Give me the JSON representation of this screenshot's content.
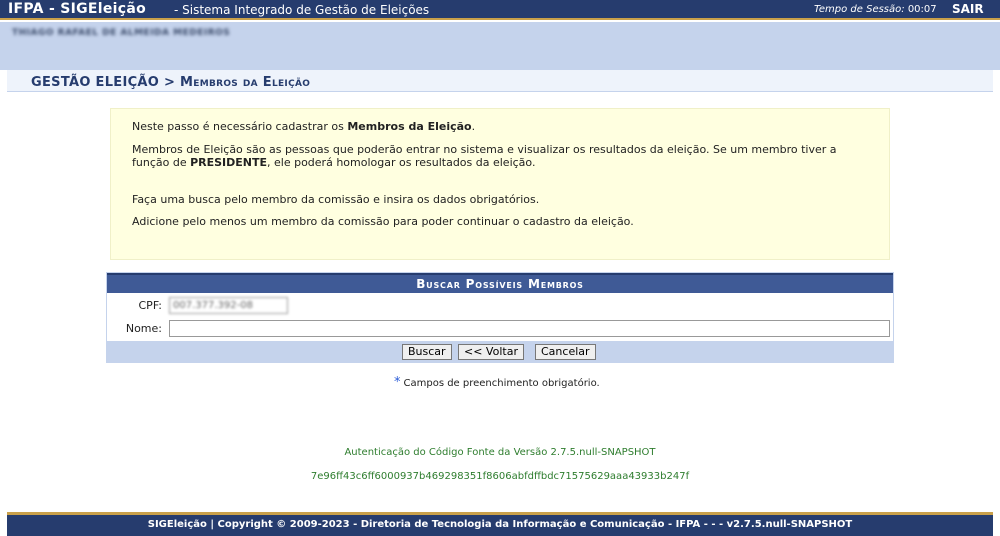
{
  "header": {
    "brand": "IFPA - SIGEleição",
    "subtitle": "- Sistema Integrado de Gestão de Eleições",
    "session_label": "Tempo de Sessão:",
    "session_time": "00:07",
    "logout_label": "SAIR"
  },
  "user": {
    "name": "THIAGO RAFAEL DE ALMEIDA MEDEIROS"
  },
  "breadcrumb": {
    "root": "GESTÃO ELEIÇÃO",
    "separator": ">",
    "current": "Membros da Eleição"
  },
  "info": {
    "line1_pre": "Neste passo é necessário cadastrar os ",
    "line1_bold": "Membros da Eleição",
    "line1_post": ".",
    "line2_pre": "Membros de Eleição são as pessoas que poderão entrar no sistema e visualizar os resultados da eleição. Se um membro tiver a função de ",
    "line2_bold": "PRESIDENTE",
    "line2_post": ", ele poderá homologar os resultados da eleição.",
    "line3": "Faça uma busca pelo membro da comissão e insira os dados obrigatórios.",
    "line4": "Adicione pelo menos um membro da comissão para poder continuar o cadastro da eleição."
  },
  "search": {
    "title": "Buscar Possíveis Membros",
    "cpf_label": "CPF:",
    "cpf_value": "007.377.392-08",
    "name_label": "Nome:",
    "name_value": "",
    "buttons": {
      "search": "Buscar",
      "back": "<< Voltar",
      "cancel": "Cancelar"
    }
  },
  "required_note": "Campos de preenchimento obrigatório.",
  "auth": {
    "line1": "Autenticação do Código Fonte da Versão 2.7.5.null-SNAPSHOT",
    "hash": "7e96ff43c6ff6000937b469298351f8606abfdffbdc71575629aaa43933b247f"
  },
  "footer": {
    "text": "SIGEleição | Copyright © 2009-2023 - Diretoria de Tecnologia da Informação e Comunicação - IFPA - - - v2.7.5.null-SNAPSHOT"
  },
  "colors": {
    "header_bg": "#263c6e",
    "accent_gold": "#c9a04a",
    "band_bg": "#c5d3ec",
    "info_bg": "#ffffe0",
    "auth_green": "#2e7d2e",
    "required_star": "#2a5bd7"
  }
}
